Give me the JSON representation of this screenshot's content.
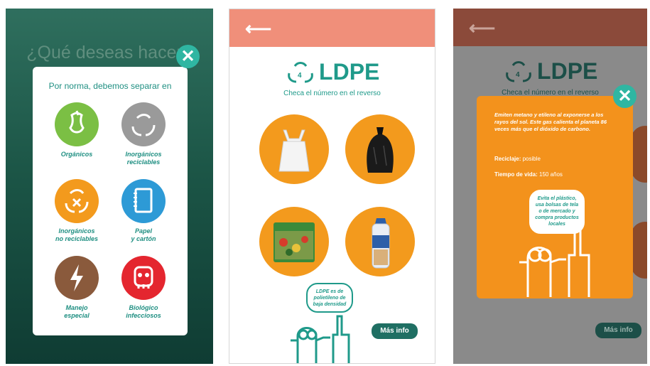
{
  "phone1": {
    "title": "¿Qué deseas hacer?",
    "heading": "Por norma, debemos separar en",
    "categories": [
      {
        "label": "Orgánicos",
        "color": "#7bbf44",
        "icon": "apple-core-icon"
      },
      {
        "label": "Inorgánicos\nreciclables",
        "color": "#9a9a9a",
        "icon": "recycle-icon"
      },
      {
        "label": "Inorgánicos\nno reciclables",
        "color": "#f39a1d",
        "icon": "recycle-cross-icon"
      },
      {
        "label": "Papel\ny cartón",
        "color": "#2d9ad6",
        "icon": "notebook-icon"
      },
      {
        "label": "Manejo\nespecial",
        "color": "#8a5a3c",
        "icon": "lightning-icon"
      },
      {
        "label": "Biológico\ninfecciosos",
        "color": "#e4262f",
        "icon": "skull-icon"
      }
    ],
    "close": "✕"
  },
  "phone2": {
    "back": "⟵",
    "logo": "LDPE",
    "subtitle": "Checa el número en el reverso",
    "items": [
      "plastic-bag-icon",
      "trash-bag-icon",
      "frozen-food-bag-icon",
      "bread-bag-icon"
    ],
    "bubble": "LDPE es de polietileno de baja densidad",
    "more_info": "Más info"
  },
  "phone3": {
    "back": "⟵",
    "logo": "LDPE",
    "subtitle": "Checa el número en el reverso",
    "popup_text": "Emiten metano y etileno al exponerse a los rayos del sol. Este gas calienta el planeta 86 veces más que el dióxido de carbono.",
    "recycling_label": "Reciclaje:",
    "recycling_value": "posible",
    "lifetime_label": "Tiempo de vida:",
    "lifetime_value": "150 años",
    "bubble": "Evita el plástico, usa bolsas de tela o de mercado y compra productos locales",
    "more_info": "Más info",
    "close": "✕"
  },
  "colors": {
    "teal": "#1f9a8a",
    "orange": "#f39a1d",
    "salmon": "#f08f7a",
    "dark_green": "#1c5647"
  }
}
